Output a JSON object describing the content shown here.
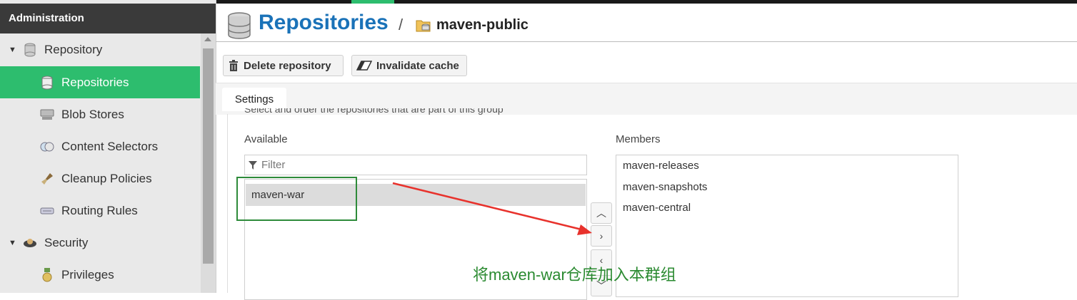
{
  "sidebar": {
    "title": "Administration",
    "items": [
      {
        "label": "Repository",
        "icon": "database-icon"
      },
      {
        "label": "Repositories",
        "icon": "database-icon"
      },
      {
        "label": "Blob Stores",
        "icon": "server-icon"
      },
      {
        "label": "Content Selectors",
        "icon": "selector-icon"
      },
      {
        "label": "Cleanup Policies",
        "icon": "brush-icon"
      },
      {
        "label": "Routing Rules",
        "icon": "route-icon"
      },
      {
        "label": "Security",
        "icon": "security-icon"
      },
      {
        "label": "Privileges",
        "icon": "medal-icon"
      }
    ]
  },
  "header": {
    "title": "Repositories",
    "separator": "/",
    "subtitle": "maven-public"
  },
  "toolbar": {
    "delete_label": "Delete repository",
    "invalidate_label": "Invalidate cache"
  },
  "tabs": {
    "settings": "Settings"
  },
  "group": {
    "hint": "Select and order the repositories that are part of this group",
    "available_label": "Available",
    "members_label": "Members",
    "filter_placeholder": "Filter",
    "available": [
      "maven-war"
    ],
    "members": [
      "maven-releases",
      "maven-snapshots",
      "maven-central"
    ]
  },
  "annotation": {
    "text": "将maven-war仓库加入本群组",
    "color": "#2a8a30",
    "arrow_color": "#e8322c"
  },
  "colors": {
    "accent": "#2dbd6e",
    "title_blue": "#1a72b8"
  }
}
